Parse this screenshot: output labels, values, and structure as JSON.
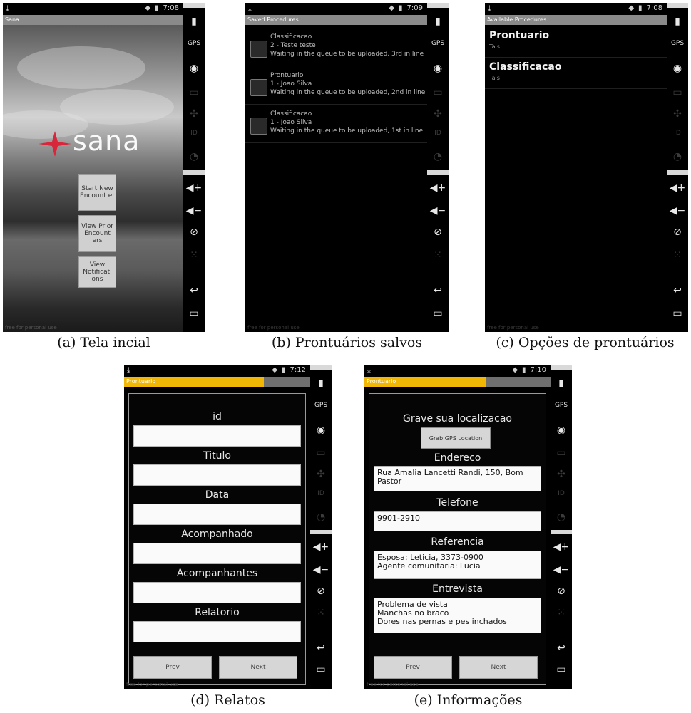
{
  "status": {
    "time_a": "7:08",
    "time_b": "7:09",
    "time_c": "7:08",
    "time_d": "7:12",
    "time_e": "7:10",
    "wifi": "wifi-icon",
    "battery": "battery-icon",
    "download": "download-icon"
  },
  "watermark": "free for personal use",
  "sidebar_icons": [
    "battery-icon",
    "gps-icon",
    "location-icon",
    "lock-icon",
    "dpad-icon",
    "id-icon",
    "rss-icon",
    "volume-up-icon",
    "volume-down-icon",
    "rotate-icon",
    "fullscreen-icon",
    "back-icon",
    "recent-apps-icon"
  ],
  "screen_a": {
    "title": "Sana",
    "logo_text": "sana",
    "buttons": [
      "Start New Encount er",
      "View Prior Encount ers",
      "View Notificati ons"
    ]
  },
  "screen_b": {
    "title": "Saved Procedures",
    "items": [
      {
        "name": "Classificacao",
        "patient": "2 - Teste teste",
        "status": "Waiting in the queue to be uploaded, 3rd in line"
      },
      {
        "name": "Prontuario",
        "patient": "1 - Joao Silva",
        "status": "Waiting in the queue to be uploaded, 2nd in line"
      },
      {
        "name": "Classificacao",
        "patient": "1 - Joao Silva",
        "status": "Waiting in the queue to be uploaded, 1st in line"
      }
    ]
  },
  "screen_c": {
    "title": "Available Procedures",
    "items": [
      {
        "name": "Prontuario",
        "author": "Tais"
      },
      {
        "name": "Classificacao",
        "author": "Tais"
      }
    ]
  },
  "screen_d": {
    "title": "Prontuario",
    "progress": 0.75,
    "fields": [
      "id",
      "Titulo",
      "Data",
      "Acompanhado",
      "Acompanhantes",
      "Relatorio"
    ],
    "prev": "Prev",
    "next": "Next"
  },
  "screen_e": {
    "title": "Prontuario",
    "progress": 0.65,
    "heading": "Grave sua localizacao",
    "gps_button": "Grab GPS Location",
    "fields": [
      {
        "label": "Endereco",
        "value": "Rua Amalia Lancetti Randi, 150, Bom\nPastor"
      },
      {
        "label": "Telefone",
        "value": "9901-2910"
      },
      {
        "label": "Referencia",
        "value": "Esposa: Leticia, 3373-0900\nAgente comunitaria: Lucia"
      },
      {
        "label": "Entrevista",
        "value": "Problema de vista\nManchas no braco\nDores nas pernas e pes inchados"
      }
    ],
    "prev": "Prev",
    "next": "Next"
  },
  "captions": [
    "(a) Tela incial",
    "(b) Prontuários salvos",
    "(c) Opções de prontuários",
    "(d) Relatos",
    "(e) Informações"
  ]
}
